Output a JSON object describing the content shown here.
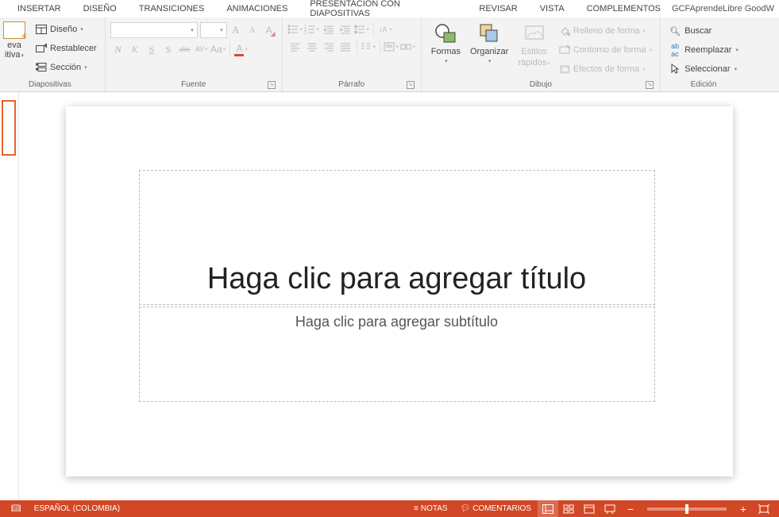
{
  "tabs": {
    "insertar": "INSERTAR",
    "diseno": "DISEÑO",
    "transiciones": "TRANSICIONES",
    "animaciones": "ANIMACIONES",
    "presentacion": "PRESENTACIÓN CON DIAPOSITIVAS",
    "revisar": "REVISAR",
    "vista": "VISTA",
    "complementos": "COMPLEMENTOS"
  },
  "user": "GCFAprendeLibre GoodW",
  "groups": {
    "diapositivas": {
      "label": "Diapositivas",
      "nueva1": "eva",
      "nueva2": "itiva",
      "diseno": "Diseño",
      "restablecer": "Restablecer",
      "seccion": "Sección"
    },
    "fuente": {
      "label": "Fuente",
      "bold": "N",
      "italic": "K",
      "underline": "S",
      "shadow": "S",
      "strike": "abc",
      "spacing": "AV",
      "case": "Aa",
      "grow": "A",
      "shrink": "A",
      "clear": "A",
      "fontcolor": "A"
    },
    "parrafo": {
      "label": "Párrafo"
    },
    "dibujo": {
      "label": "Dibujo",
      "formas": "Formas",
      "organizar": "Organizar",
      "estilos1": "Estilos",
      "estilos2": "rápidos",
      "relleno": "Relleno de forma",
      "contorno": "Contorno de forma",
      "efectos": "Efectos de forma"
    },
    "edicion": {
      "label": "Edición",
      "buscar": "Buscar",
      "reemplazar": "Reemplazar",
      "seleccionar": "Seleccionar"
    }
  },
  "slide": {
    "title_placeholder": "Haga clic para agregar título",
    "subtitle_placeholder": "Haga clic para agregar subtítulo"
  },
  "status": {
    "language": "ESPAÑOL (COLOMBIA)",
    "notas": "NOTAS",
    "comentarios": "COMENTARIOS",
    "minus": "−",
    "plus": "+"
  }
}
